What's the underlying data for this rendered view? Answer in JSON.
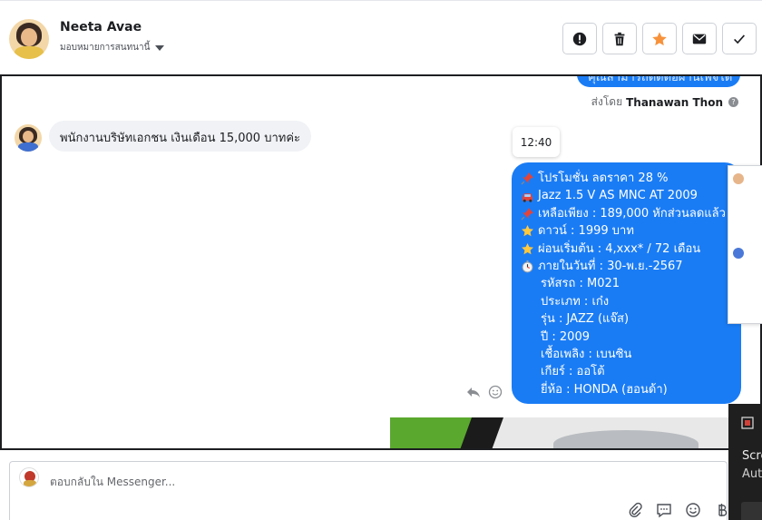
{
  "header": {
    "name": "Neeta Avae",
    "assign_label": "มอบหมายการสนทนานี้"
  },
  "actions": [
    {
      "name": "spam",
      "icon": "exclamation-icon"
    },
    {
      "name": "delete",
      "icon": "trash-icon"
    },
    {
      "name": "star",
      "icon": "star-icon",
      "color": "#f7923b"
    },
    {
      "name": "mark-unread",
      "icon": "envelope-icon"
    },
    {
      "name": "done",
      "icon": "check-icon"
    }
  ],
  "conversation": {
    "top_bubble_text": "คุณสามารถติดต่อผ่านเพจได้",
    "sent_by_prefix": "ส่งโดย",
    "sent_by_name": "Thanawan Thon",
    "incoming_message": "พนักงานบริษัทเอกชน เงินเดือน 15,000 บาทค่ะ",
    "time_label": "12:40",
    "outgoing_lines": [
      {
        "emoji": "pushpin",
        "text": "โปรโมชั่น ลดราคา 28 %"
      },
      {
        "emoji": "car",
        "text": "Jazz 1.5 V AS MNC AT 2009"
      },
      {
        "emoji": "pushpin",
        "text": "เหลือเพียง : 189,000 หักส่วนลดแล้ว"
      },
      {
        "emoji": "star",
        "text": "ดาวน์ : 1999 บาท"
      },
      {
        "emoji": "star",
        "text": "ผ่อนเริ่มต้น : 4,xxx* / 72 เดือน"
      },
      {
        "emoji": "stopwatch",
        "text": "ภายในวันที่ : 30-พ.ย.-2567"
      },
      {
        "emoji": "",
        "text": "รหัสรถ : M021"
      },
      {
        "emoji": "",
        "text": "ประเภท : เก๋ง"
      },
      {
        "emoji": "",
        "text": "รุ่น : JAZZ (แจ๊ส)"
      },
      {
        "emoji": "",
        "text": "ปี : 2009"
      },
      {
        "emoji": "",
        "text": "เชื้อเพลิง : เบนซิน"
      },
      {
        "emoji": "",
        "text": "เกียร์ : ออโต้"
      },
      {
        "emoji": "",
        "text": "ยี่ห้อ : HONDA (ฮอนด้า)"
      }
    ]
  },
  "composer": {
    "placeholder": "ตอบกลับใน Messenger..."
  },
  "toast": {
    "line1": "Scre",
    "line2": "Aut"
  },
  "colors": {
    "bubble_blue": "#1a7cf5",
    "star_orange": "#f7923b",
    "incoming_bg": "#f0f2f5"
  }
}
